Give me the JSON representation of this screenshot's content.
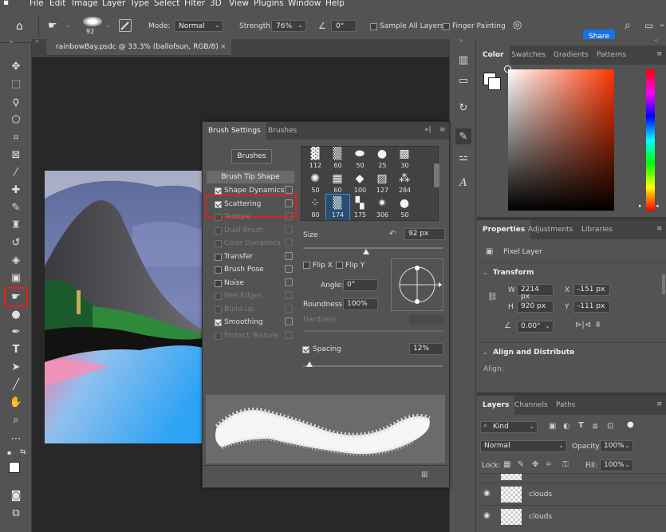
{
  "menu": [
    "File",
    "Edit",
    "Image",
    "Layer",
    "Type",
    "Select",
    "Filter",
    "3D",
    "View",
    "Plugins",
    "Window",
    "Help"
  ],
  "options": {
    "brush_size": "92",
    "mode_label": "Mode:",
    "mode_value": "Normal",
    "strength_label": "Strength:",
    "strength_value": "76%",
    "angle_value": "0°",
    "sample_all_layers": "Sample All Layers",
    "finger_painting": "Finger Painting",
    "share": "Share"
  },
  "document": {
    "tab_title": "rainbowBay.psdc @ 33.3% (ballofsun, RGB/8)"
  },
  "brush_settings": {
    "tabs": [
      "Brush Settings",
      "Brushes"
    ],
    "brushes_button": "Brushes",
    "brush_tip_shape": "Brush Tip Shape",
    "options": [
      {
        "label": "Shape Dynamics",
        "checked": true,
        "dim": false
      },
      {
        "label": "Scattering",
        "checked": true,
        "dim": false
      },
      {
        "label": "Texture",
        "checked": false,
        "dim": true
      },
      {
        "label": "Dual Brush",
        "checked": false,
        "dim": true
      },
      {
        "label": "Color Dynamics",
        "checked": false,
        "dim": true
      },
      {
        "label": "Transfer",
        "checked": false,
        "dim": false
      },
      {
        "label": "Brush Pose",
        "checked": false,
        "dim": false
      },
      {
        "label": "Noise",
        "checked": false,
        "dim": false
      },
      {
        "label": "Wet Edges",
        "checked": false,
        "dim": true
      },
      {
        "label": "Build-up",
        "checked": false,
        "dim": true
      },
      {
        "label": "Smoothing",
        "checked": true,
        "dim": false
      },
      {
        "label": "Protect Texture",
        "checked": false,
        "dim": true
      }
    ],
    "tips": [
      "112",
      "60",
      "50",
      "25",
      "30",
      "50",
      "60",
      "100",
      "127",
      "284",
      "80",
      "174",
      "175",
      "306",
      "50"
    ],
    "size_label": "Size",
    "size_value": "92 px",
    "flip_x": "Flip X",
    "flip_y": "Flip Y",
    "angle_label": "Angle:",
    "angle_value": "0°",
    "roundness_label": "Roundness:",
    "roundness_value": "100%",
    "hardness_label": "Hardness",
    "spacing_label": "Spacing",
    "spacing_value": "12%"
  },
  "color_panel": {
    "tabs": [
      "Color",
      "Swatches",
      "Gradients",
      "Patterns"
    ]
  },
  "properties": {
    "tabs": [
      "Properties",
      "Adjustments",
      "Libraries"
    ],
    "layer_type": "Pixel Layer",
    "transform_title": "Transform",
    "w_label": "W",
    "w_value": "2214 px",
    "x_label": "X",
    "x_value": "-151 px",
    "h_label": "H",
    "h_value": "920 px",
    "y_label": "Y",
    "y_value": "-111 px",
    "rotate_value": "0.00°",
    "align_title": "Align and Distribute",
    "align_label": "Align:"
  },
  "layers": {
    "tabs": [
      "Layers",
      "Channels",
      "Paths"
    ],
    "kind": "Kind",
    "blend": "Normal",
    "opacity_label": "Opacity:",
    "opacity_value": "100%",
    "lock_label": "Lock:",
    "fill_label": "Fill:",
    "fill_value": "100%",
    "rows": [
      "clouds",
      "clouds"
    ]
  }
}
